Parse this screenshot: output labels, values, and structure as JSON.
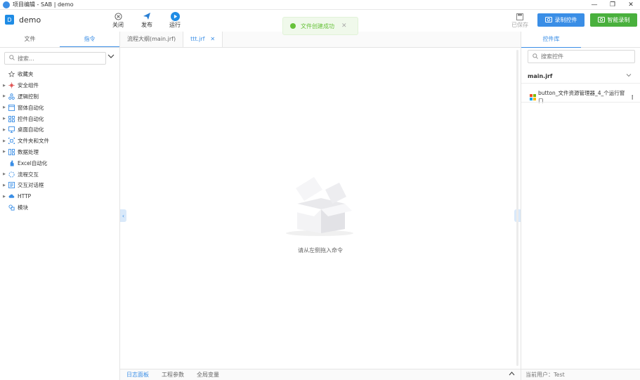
{
  "window": {
    "title": "项目编辑 - SAB | demo",
    "controls": [
      "—",
      "❐",
      "✕"
    ]
  },
  "project": {
    "badge": "D",
    "name": "demo"
  },
  "toolbar": {
    "close_label": "关闭",
    "publish_label": "发布",
    "run_label": "运行",
    "saved_label": "已保存",
    "record_label": "录制控件",
    "smart_record_label": "智能录制"
  },
  "toast": {
    "message": "文件创建成功",
    "close": "✕"
  },
  "left_panel": {
    "tabs": [
      "文件",
      "指令"
    ],
    "active_tab": "指令",
    "search_placeholder": "搜索...",
    "tree": [
      {
        "label": "收藏夹",
        "icon": "star-icon",
        "color": "#666666",
        "expandable": false
      },
      {
        "label": "安全组件",
        "icon": "shield-icon",
        "color": "#e05555",
        "expandable": true
      },
      {
        "label": "逻辑控制",
        "icon": "logic-icon",
        "color": "#3a8ee6",
        "expandable": true
      },
      {
        "label": "窗体自动化",
        "icon": "window-icon",
        "color": "#3a8ee6",
        "expandable": true
      },
      {
        "label": "控件自动化",
        "icon": "grid-icon",
        "color": "#3a8ee6",
        "expandable": true
      },
      {
        "label": "桌面自动化",
        "icon": "monitor-icon",
        "color": "#3a8ee6",
        "expandable": true
      },
      {
        "label": "文件夹和文件",
        "icon": "folder-icon",
        "color": "#3a8ee6",
        "expandable": true
      },
      {
        "label": "数据处理",
        "icon": "data-icon",
        "color": "#3a8ee6",
        "expandable": true
      },
      {
        "label": "Excel自动化",
        "icon": "excel-icon",
        "color": "#3a8ee6",
        "expandable": false
      },
      {
        "label": "流程交互",
        "icon": "flow-icon",
        "color": "#3a8ee6",
        "expandable": true
      },
      {
        "label": "交互对话框",
        "icon": "dialog-icon",
        "color": "#3a8ee6",
        "expandable": true
      },
      {
        "label": "HTTP",
        "icon": "cloud-icon",
        "color": "#3a8ee6",
        "expandable": true
      },
      {
        "label": "模块",
        "icon": "module-icon",
        "color": "#3a8ee6",
        "expandable": false
      }
    ]
  },
  "editor": {
    "tabs": [
      {
        "label": "流程大纲(main.jrf)",
        "active": false
      },
      {
        "label": "ttt.jrf",
        "active": true
      }
    ],
    "empty_text": "请从左侧拖入命令",
    "bottom_tabs": [
      "日志面板",
      "工程参数",
      "全局变量"
    ],
    "active_bottom_tab": "日志面板"
  },
  "right_panel": {
    "tab": "控件库",
    "search_placeholder": "搜索控件",
    "file_name": "main.jrf",
    "control_item": "button_文件资源管理器_4_个运行窗口",
    "footer": "当前用户：Test"
  },
  "colors": {
    "accent": "#3a8ee6",
    "success": "#67c23a",
    "smart_button": "#49b03d"
  }
}
